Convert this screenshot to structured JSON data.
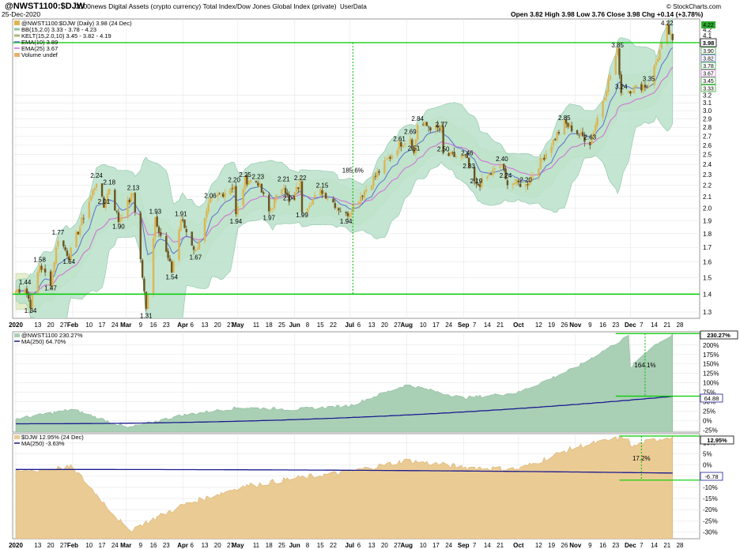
{
  "header": {
    "symbol": "@NWST1100:$DJW",
    "description": "2100news Digital Assets (crypto currency) Total Index/Dow Jones Global Index (private)",
    "userdata": "UserData",
    "date": "25-Dec-2020",
    "brand": "© StockCharts.com",
    "ohlc": "Open 3.82  High 3.98  Low 3.76  Close 3.98  Chg +0.14 (+3.78%)",
    "chg_arrow": "▲"
  },
  "legend": {
    "price": "@NWST1100:$DJW (Daily) 3.98 (24 Dec)",
    "bb": "BB(15,2.0) 3.33 - 3.78 - 4.23",
    "kelt": "KELT(15,2.0,10) 3.45 - 3.82 - 4.19",
    "ema10": "EMA(10) 3.89",
    "ema25": "EMA(25) 3.67",
    "volume": "Volume undef",
    "panel2_main": "@NWST1100 230.27%",
    "panel2_ma": "MA(250) 64.70%",
    "panel3_main": "$DJW 12.95% (24 Dec)",
    "panel3_ma": "MA(250) -3.63%"
  },
  "annotations": {
    "pct_main": "185.6%",
    "pct_p2": "164.1%",
    "pct_p3": "17.2%"
  },
  "badges": {
    "p1_top": "4.22",
    "p1_close": "3.98",
    "p1_other": [
      "3.90",
      "3.82",
      "3.78",
      "3.67",
      "3.45",
      "3.33"
    ],
    "p2_top": "230.27%",
    "p2_ma": "64.88",
    "p3_top": "12.95%",
    "p3_ma": "-6.78"
  },
  "colors": {
    "up_candle": "#dcb652",
    "down_candle": "#6b5420",
    "bb_fill": "#b8dfc8",
    "kelt_fill": "#e2ecc8",
    "ema10": "#5b6fcc",
    "ema25": "#d36bd5",
    "green_line": "#00cc00",
    "ma_line": "#1b1b8f",
    "p2_area": "#a9cfb5",
    "p3_area": "#ebcb94"
  },
  "chart_data": {
    "type": "candlestick",
    "main_price": {
      "ylim": [
        1.3,
        4.25
      ],
      "scale": "log",
      "yticks": [
        "1.3",
        "1.4",
        "1.5",
        "1.6",
        "1.7",
        "1.8",
        "1.9",
        "2.0",
        "2.1",
        "2.2",
        "2.3",
        "2.4",
        "2.5",
        "2.6",
        "2.7",
        "2.8",
        "2.9",
        "3.0",
        "3.1",
        "3.2",
        "4.2",
        "4.1",
        "4.0"
      ],
      "x_labels": [
        "2020",
        "13",
        "20",
        "27",
        "Feb",
        "10",
        "17",
        "24",
        "Mar",
        "9",
        "16",
        "23",
        "Apr",
        "6",
        "13",
        "20",
        "27",
        "May",
        "11",
        "18",
        "25",
        "Jun",
        "8",
        "15",
        "22",
        "Jul",
        "6",
        "13",
        "20",
        "27",
        "Aug",
        "10",
        "17",
        "24",
        "Sep",
        "7",
        "14",
        "21",
        "Oct",
        "12",
        "19",
        "26",
        "Nov",
        "9",
        "16",
        "23",
        "Dec",
        "7",
        "14",
        "21",
        "28"
      ],
      "swing_labels": [
        {
          "date": "2020-01-06",
          "v": 1.44
        },
        {
          "date": "2020-01-09",
          "v": 1.34
        },
        {
          "date": "2020-01-14",
          "v": 1.58
        },
        {
          "date": "2020-01-20",
          "v": 1.47
        },
        {
          "date": "2020-01-24",
          "v": 1.77
        },
        {
          "date": "2020-01-30",
          "v": 1.64
        },
        {
          "date": "2020-02-14",
          "v": 2.24
        },
        {
          "date": "2020-02-18",
          "v": 2.01
        },
        {
          "date": "2020-02-21",
          "v": 2.18
        },
        {
          "date": "2020-02-26",
          "v": 1.9
        },
        {
          "date": "2020-03-05",
          "v": 2.13
        },
        {
          "date": "2020-03-12",
          "v": 1.31
        },
        {
          "date": "2020-03-17",
          "v": 1.93
        },
        {
          "date": "2020-03-26",
          "v": 1.54
        },
        {
          "date": "2020-03-31",
          "v": 1.91
        },
        {
          "date": "2020-04-08",
          "v": 1.67
        },
        {
          "date": "2020-04-16",
          "v": 2.06
        },
        {
          "date": "2020-04-29",
          "v": 2.2
        },
        {
          "date": "2020-04-30",
          "v": 1.94
        },
        {
          "date": "2020-05-05",
          "v": 2.25
        },
        {
          "date": "2020-05-12",
          "v": 2.23
        },
        {
          "date": "2020-05-18",
          "v": 1.97
        },
        {
          "date": "2020-05-26",
          "v": 2.21
        },
        {
          "date": "2020-05-29",
          "v": 2.04
        },
        {
          "date": "2020-06-04",
          "v": 2.22
        },
        {
          "date": "2020-06-05",
          "v": 1.99
        },
        {
          "date": "2020-06-16",
          "v": 2.15
        },
        {
          "date": "2020-06-29",
          "v": 1.94
        },
        {
          "date": "2020-07-28",
          "v": 2.61
        },
        {
          "date": "2020-08-03",
          "v": 2.69
        },
        {
          "date": "2020-08-07",
          "v": 2.84
        },
        {
          "date": "2020-08-05",
          "v": 2.51
        },
        {
          "date": "2020-08-20",
          "v": 2.77
        },
        {
          "date": "2020-08-21",
          "v": 2.5
        },
        {
          "date": "2020-09-03",
          "v": 2.46
        },
        {
          "date": "2020-09-04",
          "v": 2.33
        },
        {
          "date": "2020-09-08",
          "v": 2.19
        },
        {
          "date": "2020-09-22",
          "v": 2.4
        },
        {
          "date": "2020-09-24",
          "v": 2.24
        },
        {
          "date": "2020-10-05",
          "v": 2.2
        },
        {
          "date": "2020-10-26",
          "v": 2.85
        },
        {
          "date": "2020-11-09",
          "v": 2.63
        },
        {
          "date": "2020-11-24",
          "v": 3.85
        },
        {
          "date": "2020-11-26",
          "v": 3.24
        },
        {
          "date": "2020-12-11",
          "v": 3.35
        },
        {
          "date": "2020-12-21",
          "v": 4.22
        }
      ],
      "ohlc_last": {
        "open": 3.82,
        "high": 3.98,
        "low": 3.76,
        "close": 3.98
      },
      "horizontal_lines": [
        3.98,
        1.4
      ],
      "annotation_line": {
        "date": "2020-07-01",
        "from": 1.4,
        "to": 3.98,
        "label": "185.6%"
      }
    },
    "panel2": {
      "yticks": [
        "200%",
        "175%",
        "150%",
        "125%",
        "100%",
        "75%",
        "50%",
        "25%",
        "0%",
        "-25%"
      ],
      "ylim": [
        -30,
        235
      ],
      "last": 230.27,
      "ma_last": 64.7,
      "annotation": {
        "from": 64.88,
        "to": 230.27,
        "label": "164.1%"
      },
      "series_monthly": [
        {
          "m": "Jan",
          "v": 5
        },
        {
          "m": "Feb",
          "v": 30
        },
        {
          "m": "Mar",
          "v": -20
        },
        {
          "m": "Apr",
          "v": 15
        },
        {
          "m": "May",
          "v": 35
        },
        {
          "m": "Jun",
          "v": 30
        },
        {
          "m": "Jul",
          "v": 40
        },
        {
          "m": "Aug",
          "v": 95
        },
        {
          "m": "Sep",
          "v": 60
        },
        {
          "m": "Oct",
          "v": 75
        },
        {
          "m": "Nov",
          "v": 140
        },
        {
          "m": "Dec",
          "v": 230
        }
      ]
    },
    "panel3": {
      "yticks": [
        "10%",
        "5%",
        "0%",
        "-5%",
        "-10%",
        "-15%",
        "-20%",
        "-25%",
        "-30%"
      ],
      "ylim": [
        -33,
        14
      ],
      "last": 12.95,
      "ma_last": -3.63,
      "annotation": {
        "from": -6.78,
        "to": 12.95,
        "label": "17.2%"
      },
      "series_monthly": [
        {
          "m": "Jan",
          "v": -3
        },
        {
          "m": "Feb",
          "v": -1
        },
        {
          "m": "Mar",
          "v": -30
        },
        {
          "m": "Apr",
          "v": -18
        },
        {
          "m": "May",
          "v": -10
        },
        {
          "m": "Jun",
          "v": -6
        },
        {
          "m": "Jul",
          "v": -3
        },
        {
          "m": "Aug",
          "v": 2
        },
        {
          "m": "Sep",
          "v": -1
        },
        {
          "m": "Oct",
          "v": -2
        },
        {
          "m": "Nov",
          "v": 8
        },
        {
          "m": "Dec",
          "v": 13
        }
      ]
    }
  }
}
